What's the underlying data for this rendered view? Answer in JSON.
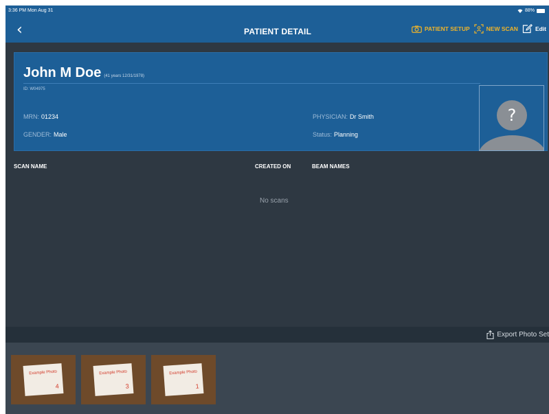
{
  "statusbar": {
    "time": "3:36 PM  Mon Aug 31",
    "battery": "88%"
  },
  "navbar": {
    "back_glyph": "‹",
    "title": "PATIENT DETAIL",
    "patient_setup": "PATIENT SETUP",
    "new_scan": "NEW SCAN",
    "edit": "Edit"
  },
  "patient": {
    "name": "John M Doe",
    "age_dob": "(41 years 12/31/1978)",
    "id": "ID: W04975",
    "mrn_label": "MRN:",
    "mrn": "01234",
    "gender_label": "GENDER:",
    "gender": "Male",
    "physician_label": "PHYSICIAN:",
    "physician": "Dr Smith",
    "status_label": "Status:",
    "status": "Planning",
    "avatar_glyph": "?"
  },
  "scans": {
    "columns": [
      "SCAN NAME",
      "CREATED ON",
      "BEAM NAMES"
    ],
    "empty_text": "No scans"
  },
  "export": {
    "label": "Export Photo Set"
  },
  "photos": [
    {
      "text": "Example Photo",
      "num": "4"
    },
    {
      "text": "Example Photo",
      "num": "3"
    },
    {
      "text": "Example Photo",
      "num": "1"
    }
  ],
  "colors": {
    "header_blue": "#1d5f97",
    "accent_yellow": "#f0b429",
    "background": "#2e3842"
  },
  "icons": [
    "back-chevron-icon",
    "camera-icon",
    "scan-icon",
    "edit-icon",
    "share-icon",
    "wifi-icon",
    "battery-icon"
  ]
}
